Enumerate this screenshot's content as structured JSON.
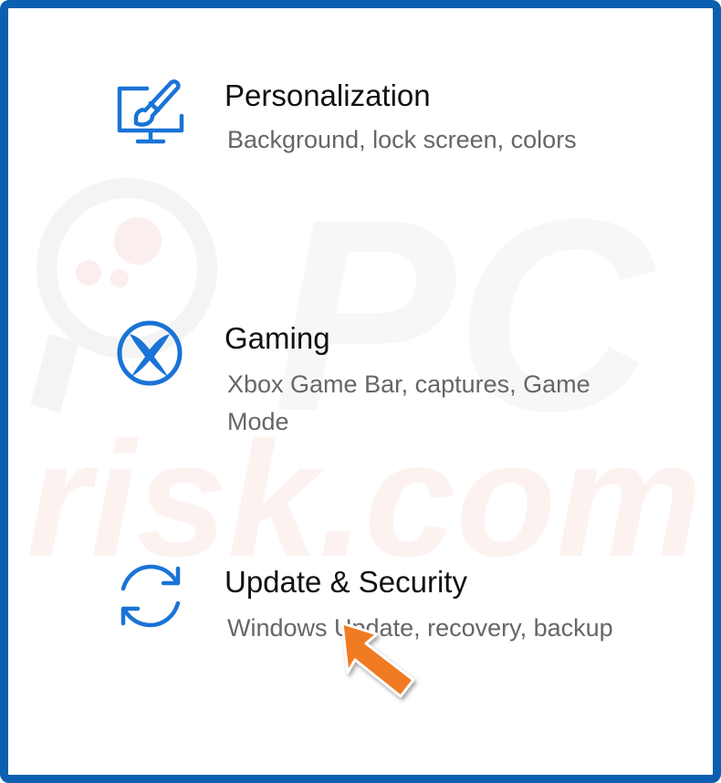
{
  "colors": {
    "border": "#0a5fb0",
    "icon_blue": "#1a73d6",
    "title_text": "#111111",
    "desc_text": "#666666",
    "arrow_fill": "#f07b22",
    "arrow_stroke": "#ffffff",
    "watermark": "#f7f7f7"
  },
  "items": [
    {
      "icon": "personalization-monitor-brush-icon",
      "title": "Personalization",
      "description": "Background, lock screen, colors"
    },
    {
      "icon": "xbox-icon",
      "title": "Gaming",
      "description": "Xbox Game Bar, captures, Game Mode"
    },
    {
      "icon": "update-sync-arrows-icon",
      "title": "Update & Security",
      "description": "Windows Update, recovery, backup"
    }
  ],
  "watermark": {
    "line1": "PC",
    "line2": "risk.com"
  }
}
